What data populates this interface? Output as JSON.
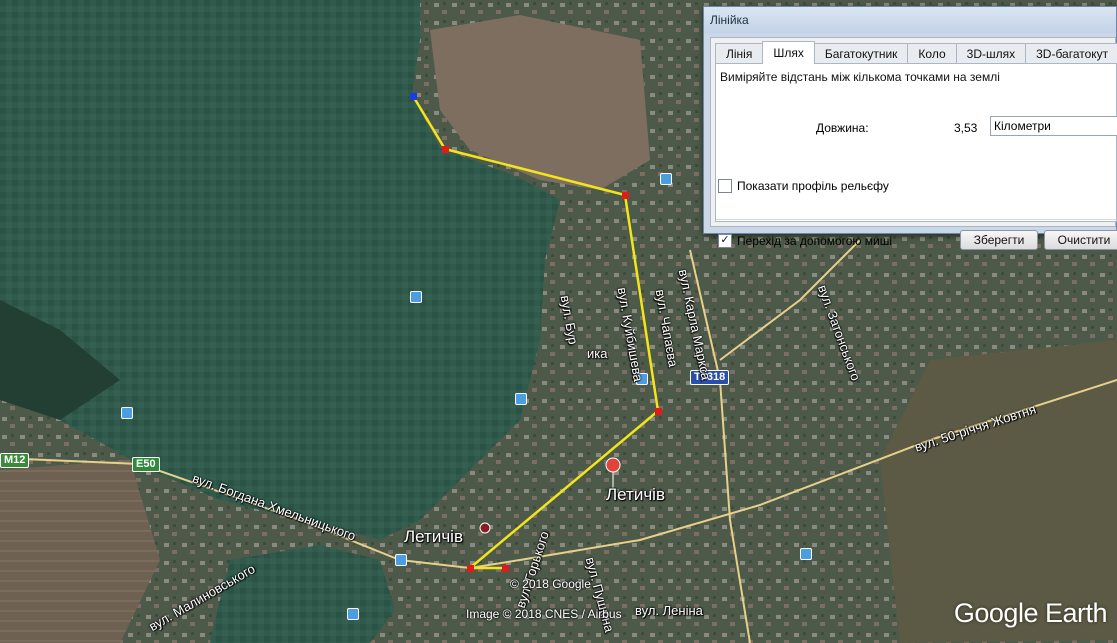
{
  "map": {
    "city_labels": [
      "Летичів",
      "Летичів"
    ],
    "street_labels": [
      "вул. Богдана Хмельницького",
      "вул. Малиновського",
      "вул. Бур",
      "ика",
      "вул. Куйбишева",
      "вул. Чапаєва",
      "вул. Карла Маркса",
      "вул. Затонського",
      "вул. 50-річчя Жовтня",
      "вул. Горького",
      "вул. Леніна",
      "вул. Пушкіна"
    ],
    "road_shields": [
      "M12",
      "E50",
      "T2318"
    ],
    "credits": [
      "© 2018 Google",
      "Image © 2018 CNES / Airbus"
    ],
    "logo": "Google Earth",
    "colors": {
      "path": "#f2e51a",
      "vertex": "#e11a1a",
      "start_vertex": "#1a3de1",
      "pin": "#e0433a"
    }
  },
  "ruler": {
    "title": "Лінійка",
    "tabs": [
      "Лінія",
      "Шлях",
      "Багатокутник",
      "Коло",
      "3D-шлях",
      "3D-багатокут"
    ],
    "active_tab": "Шлях",
    "description": "Виміряйте відстань між кількома точками на землі",
    "length_label": "Довжина:",
    "length_value": "3,53",
    "unit": "Кілометри",
    "terrain_profile_label": "Показати профіль рельєфу",
    "terrain_profile_checked": false,
    "mouse_nav_label": "Перехід за допомогою миші",
    "mouse_nav_checked": true,
    "save_label": "Зберегти",
    "clear_label": "Очистити"
  }
}
